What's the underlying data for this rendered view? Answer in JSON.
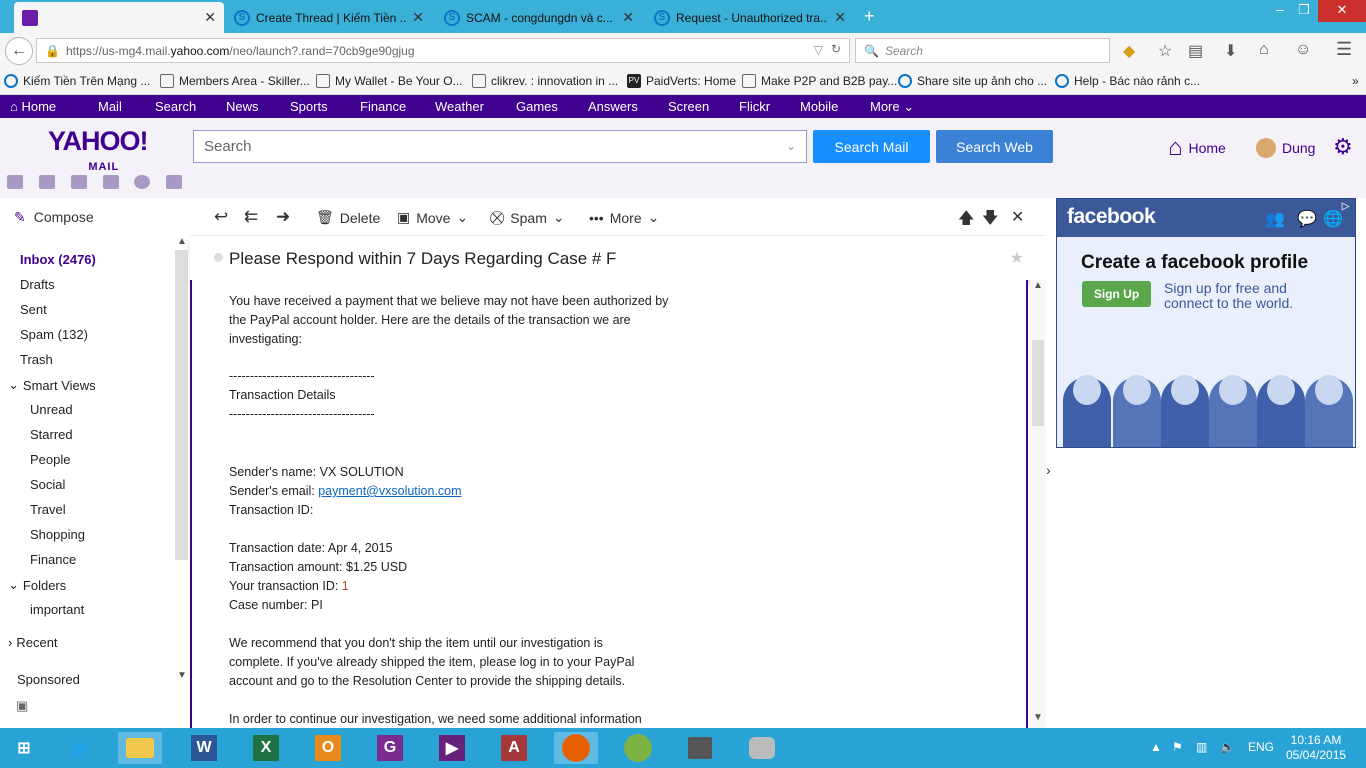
{
  "browser": {
    "tabs": [
      {
        "title": "",
        "icon": "yahoo-mail-icon",
        "active": true
      },
      {
        "title": "Create Thread | Kiếm Tiền ...",
        "icon": "site-s-icon"
      },
      {
        "title": "SCAM - congdungdn và c...",
        "icon": "site-s-icon"
      },
      {
        "title": "Request - Unauthorized tra...",
        "icon": "site-s-icon"
      }
    ],
    "url_prefix": "https://us-mg4.mail.",
    "url_domain": "yahoo.com",
    "url_suffix": "/neo/launch?.rand=70cb9ge90gjug",
    "search_placeholder": "Search",
    "bookmarks": [
      "Kiếm Tiền Trên Mạng ...",
      "Members Area - Skiller...",
      "My Wallet - Be Your O...",
      "clikrev. : innovation in ...",
      "PaidVerts: Home",
      "Make P2P and B2B pay...",
      "Share site up ảnh cho ...",
      "Help - Bác nào rảnh c..."
    ]
  },
  "yahoo_nav": {
    "items": [
      "Home",
      "Mail",
      "Search",
      "News",
      "Sports",
      "Finance",
      "Weather",
      "Games",
      "Answers",
      "Screen",
      "Flickr",
      "Mobile",
      "More"
    ]
  },
  "header": {
    "logo_top": "YAHOO!",
    "logo_bottom": "MAIL",
    "search_placeholder": "Search",
    "search_mail": "Search Mail",
    "search_web": "Search Web",
    "home": "Home",
    "user": "Dung"
  },
  "sidebar": {
    "compose": "Compose",
    "inbox": "Inbox (2476)",
    "drafts": "Drafts",
    "sent": "Sent",
    "spam": "Spam (132)",
    "trash": "Trash",
    "smart_views": "Smart Views",
    "views": [
      "Unread",
      "Starred",
      "People",
      "Social",
      "Travel",
      "Shopping",
      "Finance"
    ],
    "folders": "Folders",
    "folder_items": [
      "important"
    ],
    "recent": "Recent",
    "sponsored": "Sponsored"
  },
  "toolbar": {
    "delete": "Delete",
    "move": "Move",
    "spam": "Spam",
    "more": "More"
  },
  "message": {
    "subject": "Please Respond within 7 Days Regarding Case # F",
    "lines": [
      "You have received a payment that we believe may not have been authorized by",
      "the PayPal account holder.  Here are the details of the transaction we are",
      "investigating:",
      "",
      "-----------------------------------",
      "Transaction Details",
      "-----------------------------------",
      "",
      "",
      "Sender's name: VX SOLUTION"
    ],
    "sender_email_label": "Sender's email: ",
    "sender_email": "payment@vxsolution.com",
    "transaction_id": "Transaction ID:",
    "transaction_date": "Transaction date: Apr 4, 2015",
    "transaction_amount": "Transaction amount: $1.25 USD",
    "your_transaction_id_label": "Your transaction ID: ",
    "your_transaction_id_value": "1",
    "case_number": "Case number: PI",
    "para2": [
      "We recommend that you don't ship the item until our investigation is",
      "complete.  If you've already shipped the item, please log in to your PayPal",
      "account and go to the Resolution Center to provide the shipping details."
    ],
    "para3": "In order to continue our investigation, we need some additional information"
  },
  "ad": {
    "brand": "facebook",
    "title": "Create a facebook profile",
    "button": "Sign Up",
    "tagline": "Sign up for free and connect to the world."
  },
  "taskbar": {
    "lang": "ENG",
    "time": "10:16 AM",
    "date": "05/04/2015"
  }
}
